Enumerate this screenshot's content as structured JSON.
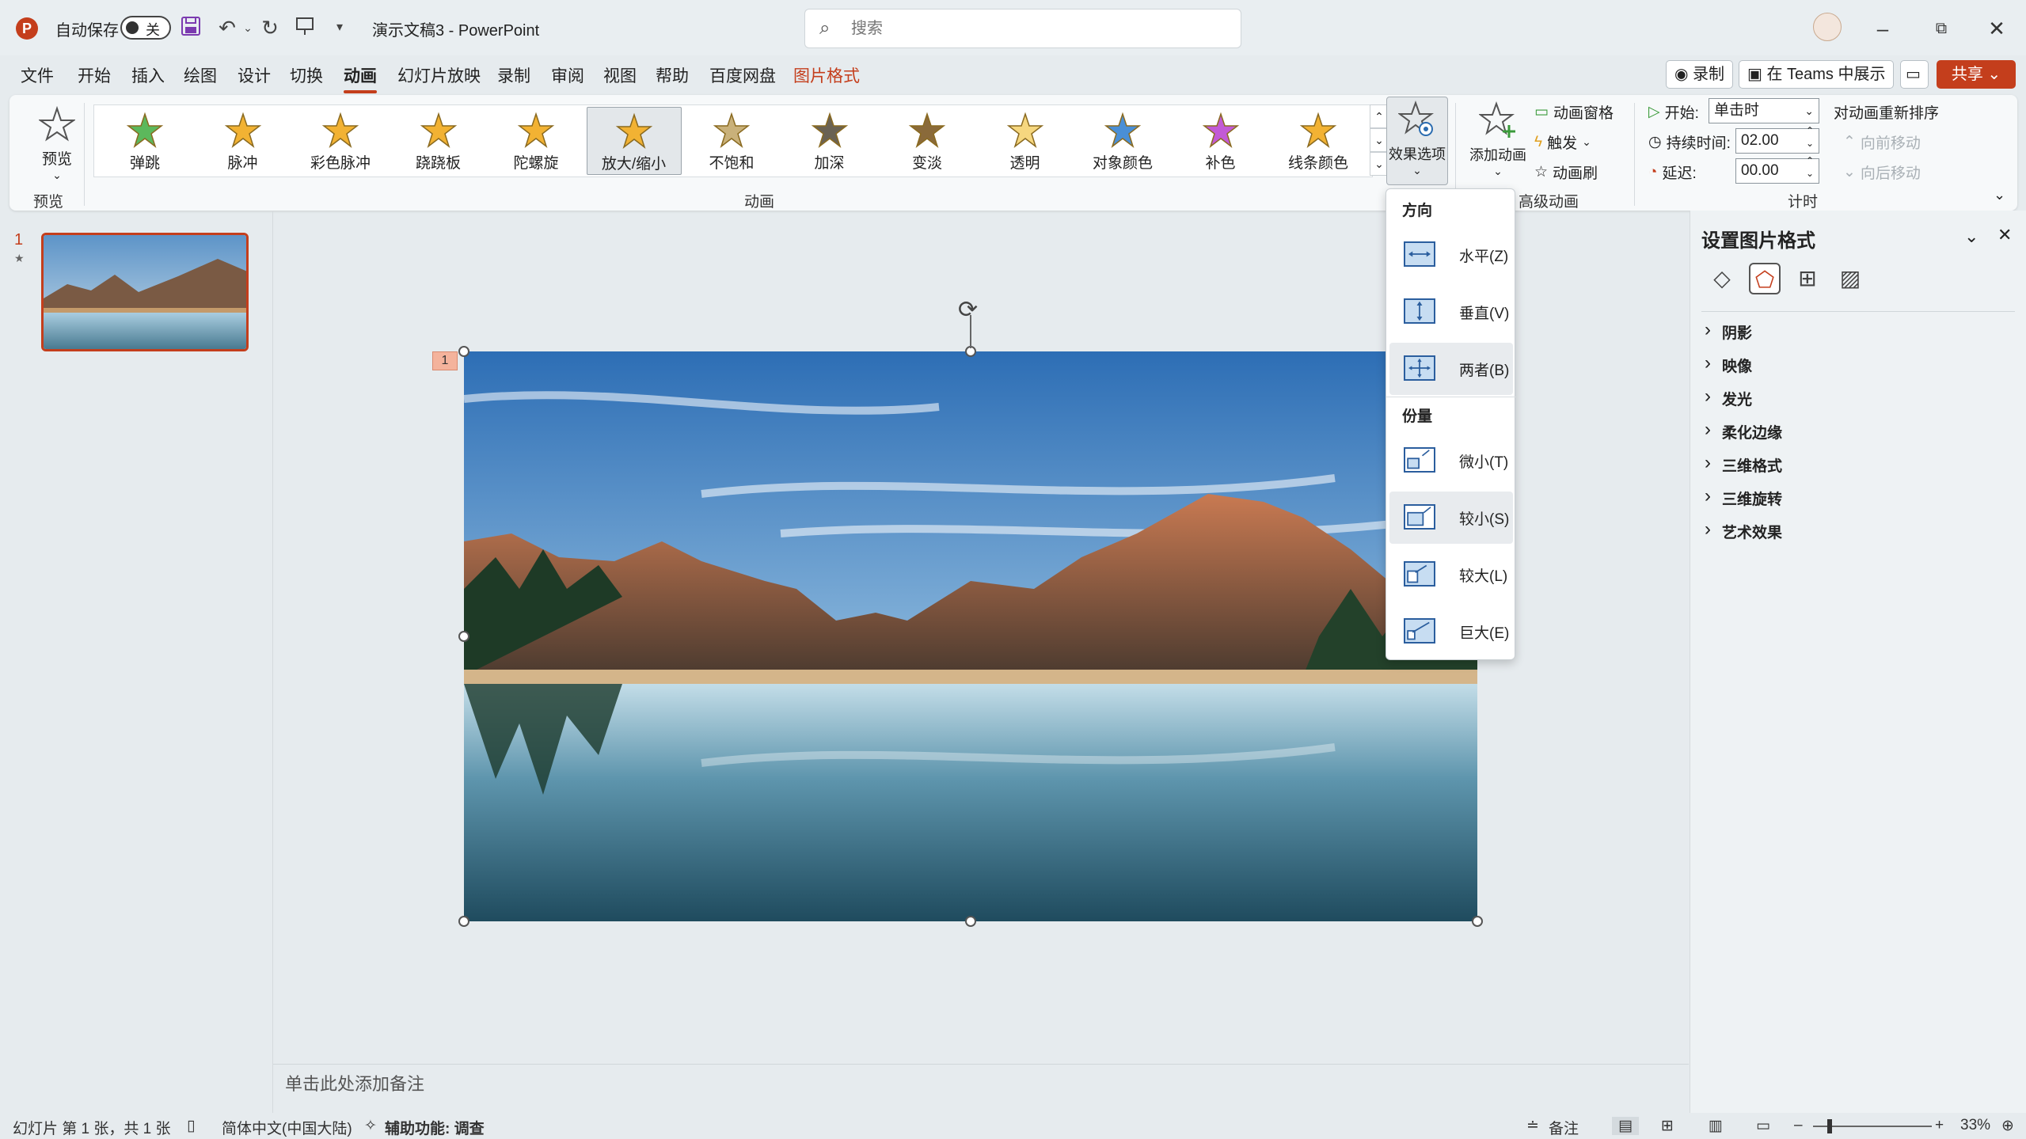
{
  "titlebar": {
    "autosave_label": "自动保存",
    "autosave_state": "关",
    "doc_title": "演示文稿3 - PowerPoint",
    "search_placeholder": "搜索"
  },
  "tabs": [
    "文件",
    "开始",
    "插入",
    "绘图",
    "设计",
    "切换",
    "动画",
    "幻灯片放映",
    "录制",
    "审阅",
    "视图",
    "帮助",
    "百度网盘",
    "图片格式"
  ],
  "active_tab": "动画",
  "contextual_tab": "图片格式",
  "tab_actions": {
    "record": "录制",
    "teams": "在 Teams 中展示",
    "share": "共享"
  },
  "ribbon": {
    "preview": {
      "label": "预览",
      "group": "预览"
    },
    "animations": {
      "group": "动画",
      "items": [
        {
          "label": "弹跳",
          "color": "#5cb85c"
        },
        {
          "label": "脉冲",
          "color": "#f2b233"
        },
        {
          "label": "彩色脉冲",
          "color": "#f2b233"
        },
        {
          "label": "跷跷板",
          "color": "#f2b233"
        },
        {
          "label": "陀螺旋",
          "color": "#f2b233"
        },
        {
          "label": "放大/缩小",
          "color": "#f2b233"
        },
        {
          "label": "不饱和",
          "color": "#c9b17a"
        },
        {
          "label": "加深",
          "color": "#6a6253"
        },
        {
          "label": "变淡",
          "color": "#8a6a3a"
        },
        {
          "label": "透明",
          "color": "#f6d77f"
        },
        {
          "label": "对象颜色",
          "color": "#4a8fd6"
        },
        {
          "label": "补色",
          "color": "#c25ad6"
        },
        {
          "label": "线条颜色",
          "color": "#f2b233"
        }
      ],
      "selected_index": 5
    },
    "effect_options": "效果选项",
    "advanced": {
      "group": "高级动画",
      "add_animation": "添加动画",
      "pane": "动画窗格",
      "trigger": "触发",
      "painter": "动画刷"
    },
    "timing": {
      "group": "计时",
      "start_label": "开始:",
      "start_value": "单击时",
      "duration_label": "持续时间:",
      "duration_value": "02.00",
      "delay_label": "延迟:",
      "delay_value": "00.00",
      "reorder": "对动画重新排序",
      "move_earlier": "向前移动",
      "move_later": "向后移动"
    }
  },
  "effect_menu": {
    "direction_header": "方向",
    "direction_items": [
      "水平(Z)",
      "垂直(V)",
      "两者(B)"
    ],
    "amount_header": "份量",
    "amount_items": [
      "微小(T)",
      "较小(S)",
      "较大(L)",
      "巨大(E)"
    ]
  },
  "slides": {
    "number": "1",
    "star": "★"
  },
  "anim_badge": "1",
  "notes_placeholder": "单击此处添加备注",
  "format_pane": {
    "title": "设置图片格式",
    "sections": [
      "阴影",
      "映像",
      "发光",
      "柔化边缘",
      "三维格式",
      "三维旋转",
      "艺术效果"
    ]
  },
  "statusbar": {
    "slide_info": "幻灯片 第 1 张，共 1 张",
    "language": "简体中文(中国大陆)",
    "accessibility": "辅助功能: 调查",
    "notes": "备注",
    "zoom": "33%"
  }
}
